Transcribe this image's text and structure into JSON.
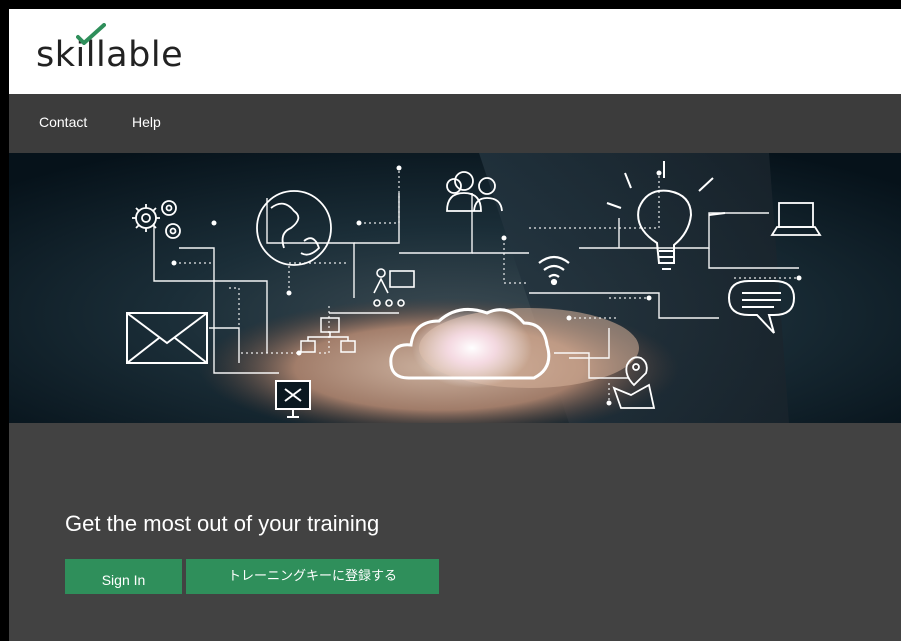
{
  "brand": {
    "logo_text": "skillable",
    "logo_color": "#222222",
    "check_color": "#2f8f5b"
  },
  "nav": {
    "items": [
      {
        "label": "Contact"
      },
      {
        "label": "Help"
      }
    ],
    "background": "#3c3c3c"
  },
  "hero": {
    "description_icons": [
      "gears-icon",
      "globe-icon",
      "people-icon",
      "lightbulb-icon",
      "laptop-icon",
      "envelope-icon",
      "wifi-icon",
      "presenter-icon",
      "network-icon",
      "cloud-icon",
      "chat-bubble-icon",
      "monitor-icon",
      "map-pin-icon"
    ]
  },
  "main": {
    "tagline": "Get the most out of your training",
    "sign_in_label": "Sign In",
    "register_label": "トレーニングキーに登録する",
    "button_color": "#2f8f5b",
    "background": "#424242"
  }
}
